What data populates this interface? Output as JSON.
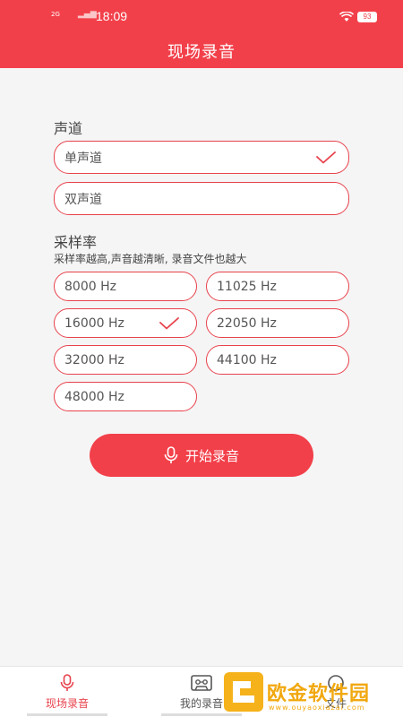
{
  "status_bar": {
    "network": "2G",
    "time": "18:09",
    "battery": "93"
  },
  "header": {
    "title": "现场录音"
  },
  "channel": {
    "label": "声道",
    "options": [
      {
        "label": "单声道",
        "selected": true
      },
      {
        "label": "双声道",
        "selected": false
      }
    ]
  },
  "sample_rate": {
    "label": "采样率",
    "hint": "采样率越高,声音越清晰, 录音文件也越大",
    "options": [
      {
        "label": "8000 Hz",
        "selected": false
      },
      {
        "label": "11025 Hz",
        "selected": false
      },
      {
        "label": "16000 Hz",
        "selected": true
      },
      {
        "label": "22050 Hz",
        "selected": false
      },
      {
        "label": "32000 Hz",
        "selected": false
      },
      {
        "label": "44100 Hz",
        "selected": false
      },
      {
        "label": "48000 Hz",
        "selected": false
      }
    ]
  },
  "start_button": {
    "label": "开始录音",
    "icon": "microphone-icon"
  },
  "bottom_nav": {
    "items": [
      {
        "label": "现场录音",
        "icon": "microphone-icon",
        "active": true
      },
      {
        "label": "我的录音",
        "icon": "cassette-icon",
        "active": false
      },
      {
        "label": "文件",
        "icon": "settings-icon",
        "active": false
      }
    ]
  },
  "watermark": {
    "text": "欧金软件园",
    "subtext": "www.ouyaoxiazai.com"
  },
  "colors": {
    "accent": "#f2404a",
    "background": "#f5f5f5",
    "watermark": "#f5b21b"
  }
}
